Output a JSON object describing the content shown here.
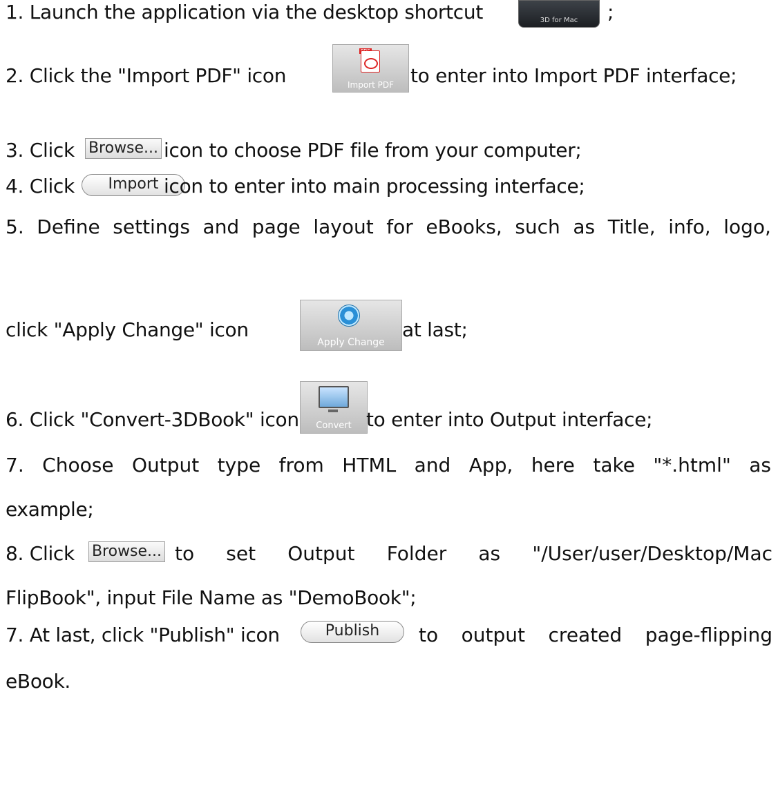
{
  "lines": {
    "l1a": "1. Launch the application via the desktop shortcut",
    "l1b": ";",
    "l2a": "2. Click the \"Import PDF\" icon",
    "l2b": "to enter into Import PDF interface;",
    "l3a": "3. Click",
    "l3b": "icon to choose PDF file from your computer;",
    "l4a": "4. Click",
    "l4b": "icon to enter into main processing interface;",
    "l5": [
      "5.",
      "Define",
      "settings",
      "and",
      "page",
      "layout",
      "for",
      "eBooks,",
      "such",
      "as",
      "Title,",
      "info,",
      "logo,"
    ],
    "l5ba": "click \"Apply Change\" icon",
    "l5bb": "at last;",
    "l6a": "6. Click \"Convert-3DBook\" icon",
    "l6b": "to enter into Output interface;",
    "l7": [
      "7.",
      "Choose",
      "Output",
      "type",
      "from",
      "HTML",
      "and",
      "App,",
      "here",
      "take",
      "\"*.html\"",
      "as"
    ],
    "l7b": "example;",
    "l8a": "8. Click",
    "l8b": [
      "to",
      "set",
      "Output",
      "Folder",
      "as",
      "\"/User/user/Desktop/Mac"
    ],
    "l8c": "FlipBook\", input File Name as \"DemoBook\";",
    "l9a": "7. At last, click \"Publish\" icon",
    "l9b": [
      "to",
      "output",
      "created",
      "page-flipping"
    ],
    "l9c": "eBook."
  },
  "icons": {
    "shortcut_label": "3D for Mac",
    "import_pdf_label": "Import PDF",
    "pdf_tag": "PDF",
    "browse_label": "Browse...",
    "import_label": "Import",
    "apply_change_label": "Apply Change",
    "convert_label": "Convert",
    "publish_label": "Publish"
  }
}
